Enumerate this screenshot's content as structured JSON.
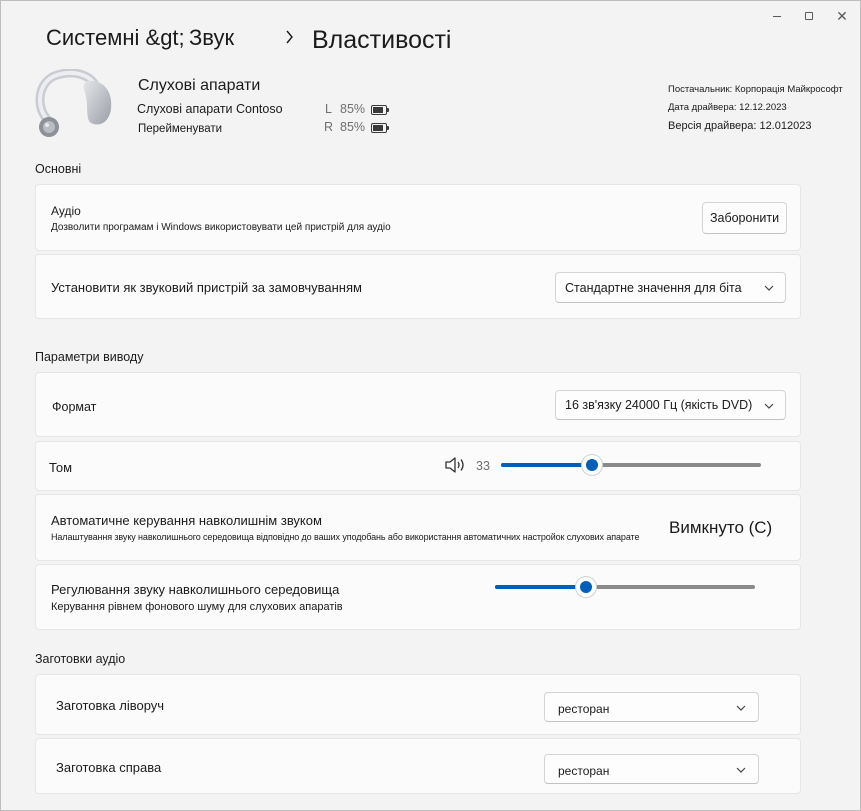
{
  "window": {
    "minimize_icon": "minimize-icon",
    "maximize_icon": "maximize-icon",
    "close_icon": "close-icon"
  },
  "breadcrumb": {
    "item1": "Системні &gt;",
    "item2": "Звук",
    "separator_icon": "chevron-right-icon",
    "current": "Властивості"
  },
  "device": {
    "image_icon": "hearing-aid-icon",
    "title": "Слухові апарати",
    "model": "Слухові апарати Contoso",
    "rename_link": "Перейменувати",
    "battery_left": {
      "label": "L",
      "value": "85%",
      "level": 0.85
    },
    "battery_right": {
      "label": "R",
      "value": "85%",
      "level": 0.85
    }
  },
  "driver": {
    "provider": "Постачальник: Корпорація Майкрософт",
    "date": "Дата драйвера: 12.12.2023",
    "version": "Версія драйвера: 12.012023"
  },
  "sections": {
    "general": "Основні",
    "output": "Параметри виводу",
    "presets": "Заготовки аудіо"
  },
  "audio": {
    "title": "Аудіо",
    "description": "Дозволити програмам і Windows використовувати цей пристрій для аудіо",
    "button": "Заборонити"
  },
  "default_device": {
    "title": "Установити як звуковий пристрій за замовчуванням",
    "value": "Стандартне значення для біта"
  },
  "format": {
    "title": "Формат",
    "value": "16 зв'язку 24000 Гц (якість DVD)"
  },
  "volume": {
    "title": "Том",
    "icon": "speaker-icon",
    "value": "33",
    "level": 0.35
  },
  "ambient_auto": {
    "title": "Автоматичне керування навколишнім звуком",
    "description": "Налаштування звуку навколишнього середовища відповідно до ваших уподобань або використання автоматичних настройок слухових апарате",
    "state": "Вимкнуто (С)"
  },
  "ambient_level": {
    "title": "Регулювання звуку навколишнього середовища",
    "description": "Керування рівнем фонового шуму для слухових апаратів",
    "level": 0.35
  },
  "preset_left": {
    "title": "Заготовка ліворуч",
    "value": "ресторан"
  },
  "preset_right": {
    "title": "Заготовка справа",
    "value": "ресторан"
  },
  "colors": {
    "accent": "#005fb8",
    "background": "#f3f3f3",
    "card": "#fbfbfb"
  }
}
